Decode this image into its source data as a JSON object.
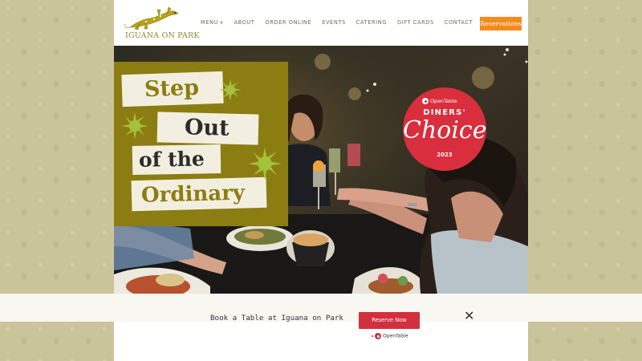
{
  "brand": {
    "logo_text": "IGUANA ON PARK",
    "accent_color": "#8c7d12",
    "orange_color": "#f28b1c",
    "red_color": "#d3303f"
  },
  "nav": {
    "items": [
      {
        "label": "MENU",
        "has_dropdown": true
      },
      {
        "label": "ABOUT"
      },
      {
        "label": "ORDER ONLINE"
      },
      {
        "label": "EVENTS"
      },
      {
        "label": "CATERING"
      },
      {
        "label": "GIFT CARDS"
      },
      {
        "label": "CONTACT"
      }
    ],
    "reservations_label": "Reservations"
  },
  "hero": {
    "headline": [
      "Step",
      "Out",
      "of the",
      "Ordinary"
    ]
  },
  "badge": {
    "brand": "OpenTable",
    "line1": "DINERS'",
    "line2": "Choice",
    "year": "2023"
  },
  "booking": {
    "text": "Book a Table at Iguana on Park",
    "button_label": "Reserve Now",
    "close_icon": "close-icon",
    "powered_by": "OpenTable"
  }
}
